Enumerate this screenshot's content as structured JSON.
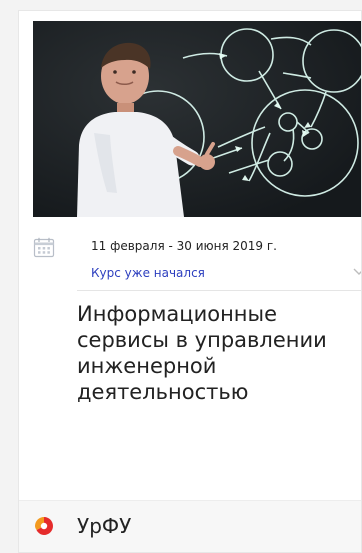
{
  "course": {
    "dates": "11 февраля - 30 июня 2019 г.",
    "status": "Курс уже начался",
    "title": "Информационные сервисы в управлении инженерной деятельностью"
  },
  "provider": {
    "name": "УрФУ"
  },
  "icons": {
    "calendar": "calendar-icon",
    "chevron": "chevron-down-icon",
    "logo": "urfu-logo-icon"
  },
  "colors": {
    "accent": "#2d3fbf",
    "text": "#222222",
    "background": "#f3f3f3"
  }
}
